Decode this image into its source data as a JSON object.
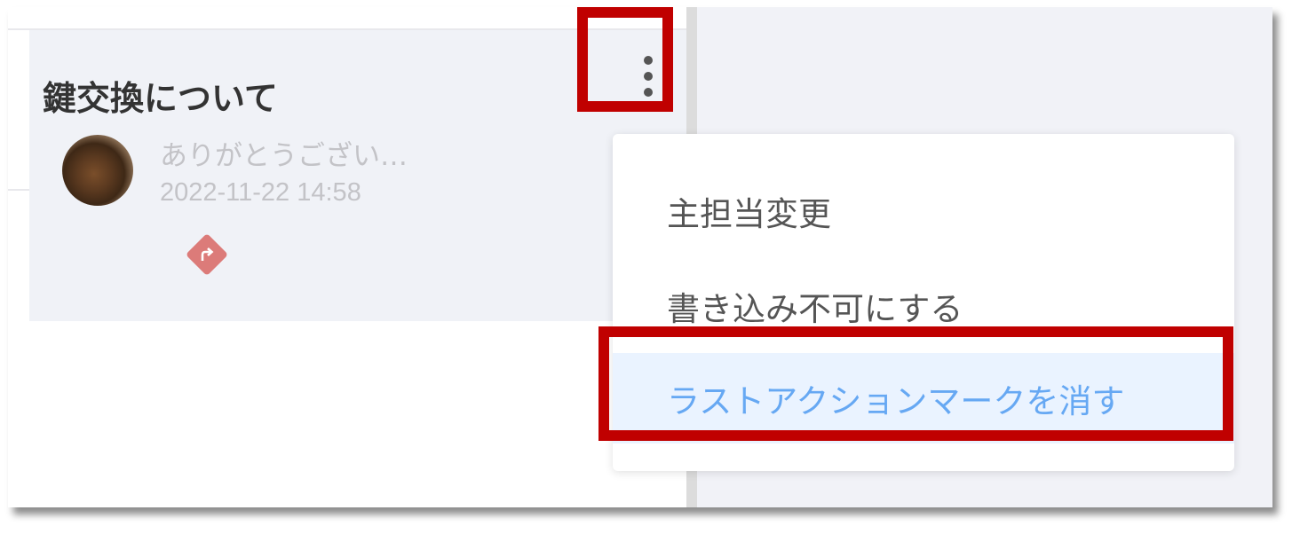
{
  "conversation": {
    "title": "鍵交換について",
    "preview": "ありがとうござい…",
    "timestamp": "2022-11-22 14:58",
    "last_action_icon": "forward-arrow-icon",
    "more_icon": "kebab-menu-icon"
  },
  "context_menu": {
    "items": [
      {
        "label": "主担当変更"
      },
      {
        "label": "書き込み不可にする"
      },
      {
        "label": "ラストアクションマークを消す",
        "hovered": true
      }
    ]
  },
  "colors": {
    "highlight_border": "#c00000",
    "active_item_bg": "#eaf3ff",
    "active_item_text": "#66a8f3",
    "action_badge": "#dc7b79",
    "card_bg": "#f0f2f7"
  }
}
